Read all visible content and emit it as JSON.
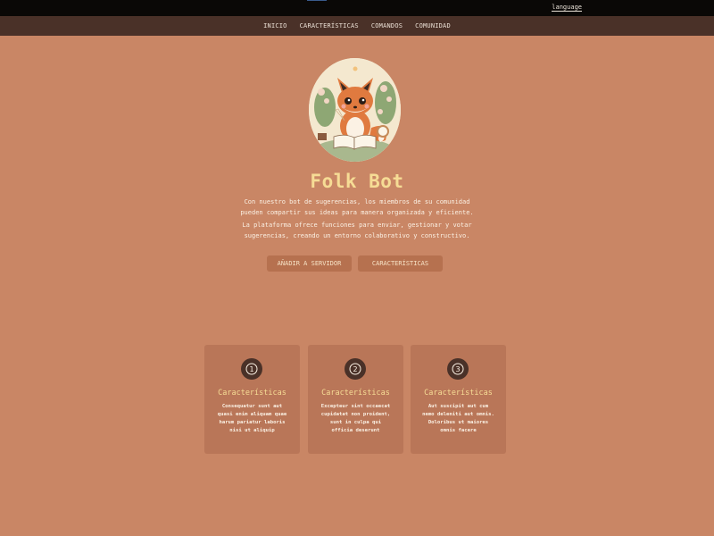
{
  "topbar": {
    "language_link": "language"
  },
  "nav": {
    "items": [
      "INICIO",
      "CARACTERÍSTICAS",
      "COMANDOS",
      "COMUNIDAD"
    ]
  },
  "hero": {
    "image_icon": "fox-reading-book-illustration",
    "title": "Folk Bot",
    "paragraph1": "Con nuestro bot de sugerencias, los miembros de su comunidad pueden compartir sus ideas para manera organizada y eficiente.",
    "paragraph2": "La plataforma ofrece funciones para enviar, gestionar y votar sugerencias, creando un entorno colaborativo y constructivo.",
    "add_button": "AÑADIR A SERVIDOR",
    "features_button": "CARACTERÍSTICAS"
  },
  "features": [
    {
      "number": "1",
      "title": "Características",
      "text": "Consequatur sunt aut quasi enim aliquam quae harum pariatur laboris nisi ut aliquip"
    },
    {
      "number": "2",
      "title": "Características",
      "text": "Excepteur sint occaecat cupidatat non proident, sunt in culpa qui officia deserunt"
    },
    {
      "number": "3",
      "title": "Características",
      "text": "Aut suscipit aut cum nemo deleniti aut omnis. Doloribus ut maiores omnis facere"
    }
  ],
  "colors": {
    "background": "#c98665",
    "nav": "#4a3128",
    "title": "#f6dc95",
    "button": "#b6714f",
    "card": "#b97658"
  }
}
